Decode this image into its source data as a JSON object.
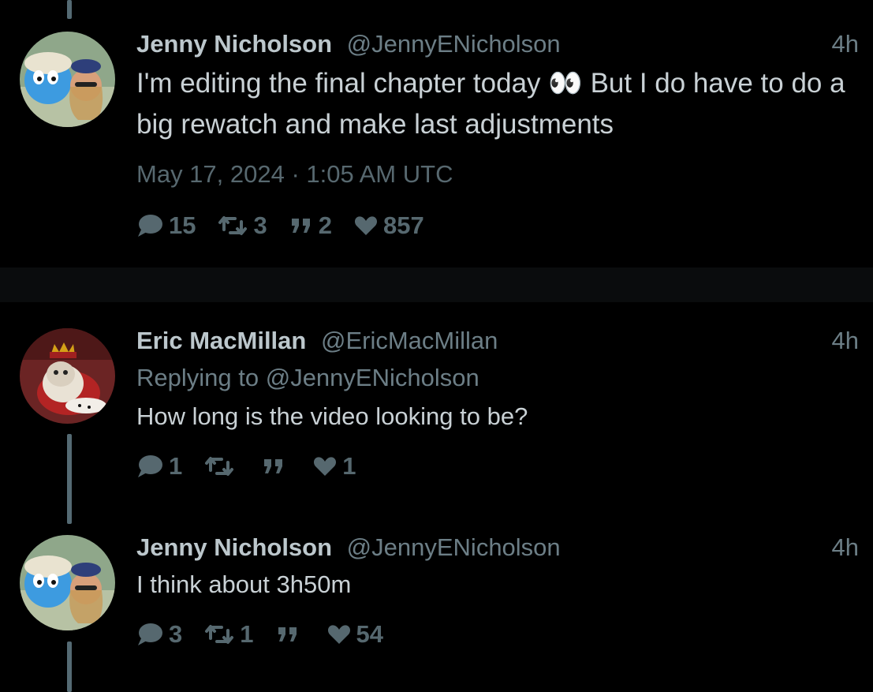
{
  "tweets": [
    {
      "author": "Jenny Nicholson",
      "handle": "@JennyENicholson",
      "time": "4h",
      "text": "I'm editing the final chapter today 👀 But I do have to do a big rewatch and make last adjustments",
      "date": "May 17, 2024 · 1:05 AM UTC",
      "stats": {
        "replies": "15",
        "retweets": "3",
        "quotes": "2",
        "likes": "857"
      }
    },
    {
      "author": "Eric MacMillan",
      "handle": "@EricMacMillan",
      "time": "4h",
      "replying_label": "Replying to",
      "replying_handle": "@JennyENicholson",
      "text": "How long is the video looking to be?",
      "stats": {
        "replies": "1",
        "retweets": "",
        "quotes": "",
        "likes": "1"
      }
    },
    {
      "author": "Jenny Nicholson",
      "handle": "@JennyENicholson",
      "time": "4h",
      "text": "I think about 3h50m",
      "stats": {
        "replies": "3",
        "retweets": "1",
        "quotes": "",
        "likes": "54"
      }
    }
  ],
  "icons": {
    "reply": "comment-icon",
    "retweet": "retweet-icon",
    "quote": "quote-icon",
    "like": "heart-icon"
  },
  "colors": {
    "background": "#000000",
    "author": "#bcc7cc",
    "secondary": "#6c7e86",
    "thread_line": "#546a73"
  }
}
